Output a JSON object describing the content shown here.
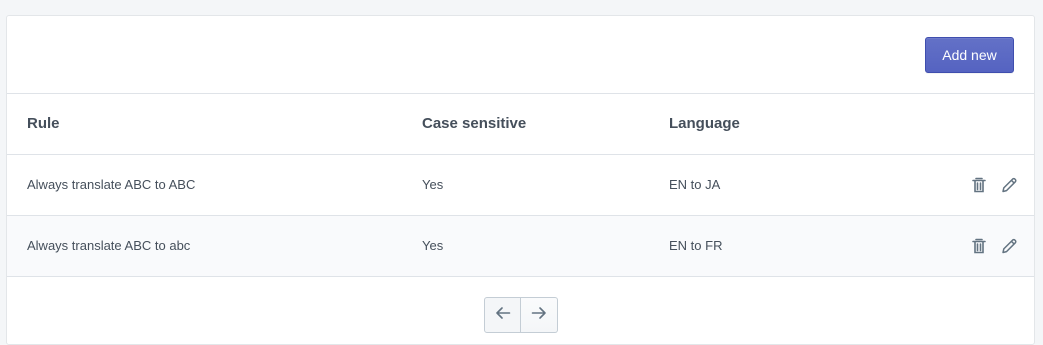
{
  "header": {
    "add_button_label": "Add new"
  },
  "table": {
    "columns": [
      "Rule",
      "Case sensitive",
      "Language"
    ],
    "rows": [
      {
        "rule": "Always translate ABC to ABC",
        "case_sensitive": "Yes",
        "language": "EN to JA"
      },
      {
        "rule": "Always translate ABC to abc",
        "case_sensitive": "Yes",
        "language": "EN to FR"
      }
    ],
    "row_actions": [
      "trash-icon",
      "pencil-icon"
    ]
  },
  "pagination": {
    "prev_icon": "arrow-left-icon",
    "next_icon": "arrow-right-icon"
  },
  "colors": {
    "accent": "#5c6ac4",
    "text": "#454f5b",
    "icon": "#637381",
    "border": "#dfe3e8",
    "page_background": "#f4f6f8"
  }
}
